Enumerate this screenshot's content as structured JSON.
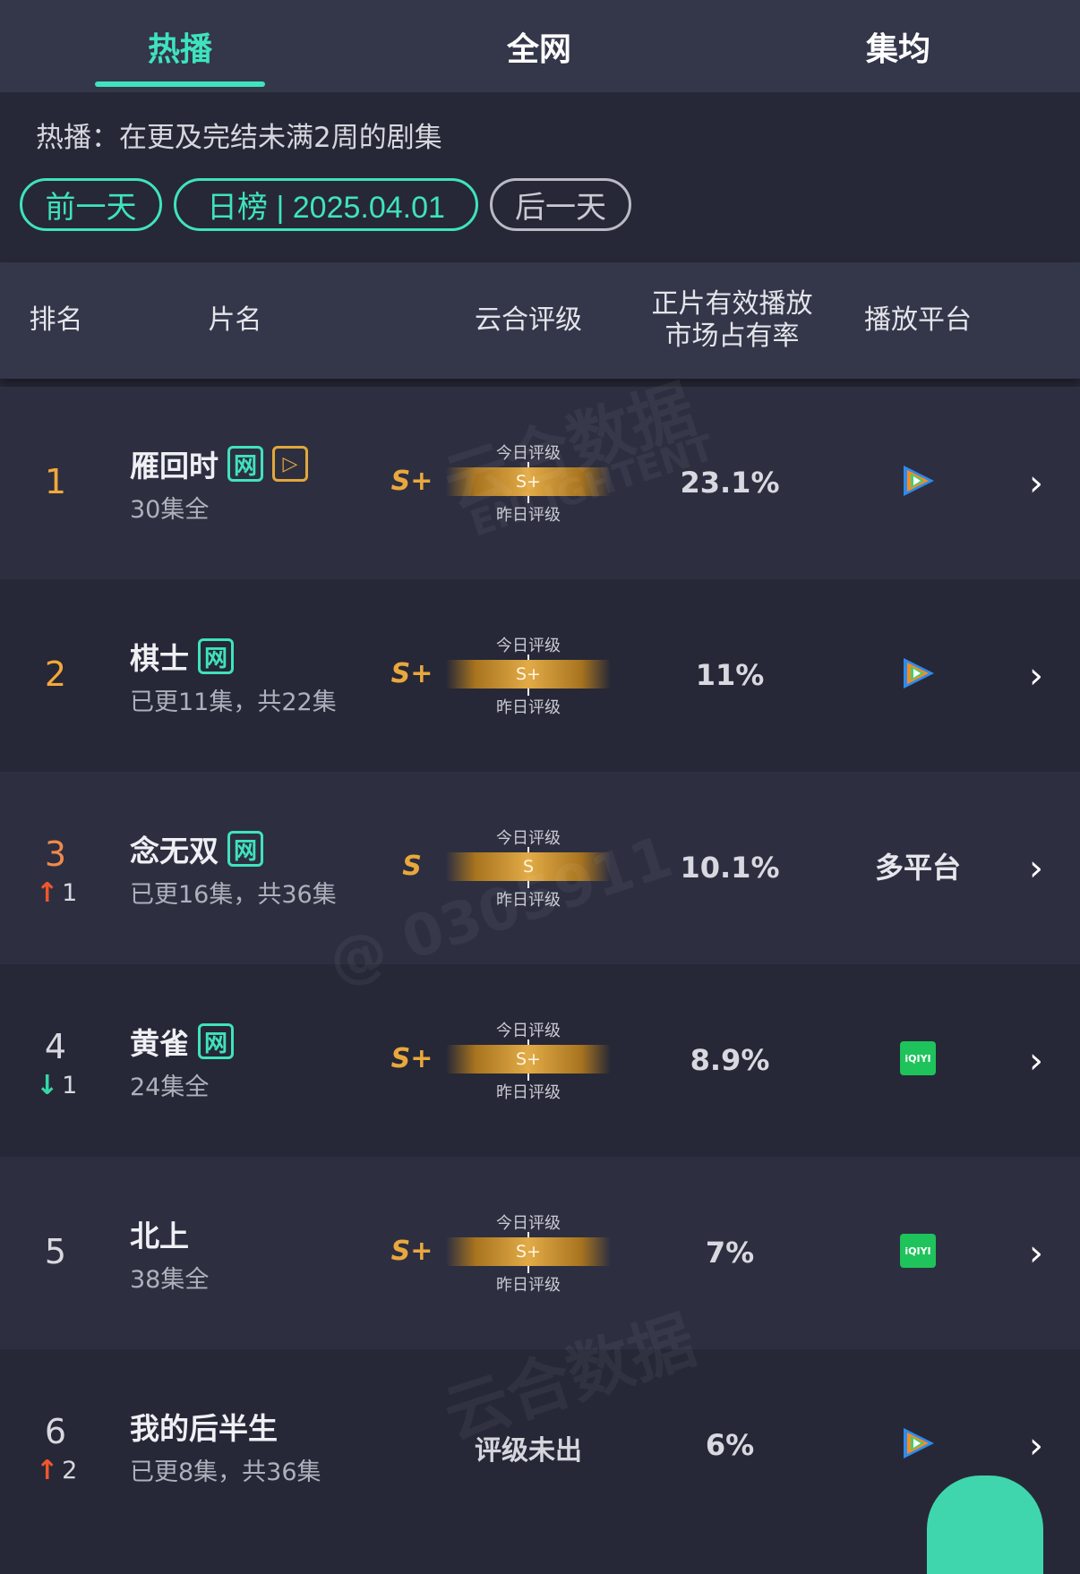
{
  "tabs": [
    {
      "label": "热播",
      "active": true
    },
    {
      "label": "全网",
      "active": false
    },
    {
      "label": "集均",
      "active": false
    }
  ],
  "description": "热播：在更及完结未满2周的剧集",
  "date_nav": {
    "prev_label": "前一天",
    "current_label": "日榜 | 2025.04.01",
    "next_label": "后一天"
  },
  "columns": {
    "rank": "排名",
    "title": "片名",
    "grade": "云合评级",
    "share_line1": "正片有效播放",
    "share_line2": "市场占有率",
    "platform": "播放平台"
  },
  "grade_labels": {
    "today": "今日评级",
    "yesterday": "昨日评级"
  },
  "watermark": {
    "brand": "云合数据",
    "en": "ENLIGHTENT",
    "handle": "@ 0305911"
  },
  "rows": [
    {
      "rank": "1",
      "change": "",
      "title": "雁回时",
      "tags": [
        "网",
        "▷"
      ],
      "subtitle": "30集全",
      "grade": "S+",
      "bar_grade": "S+",
      "share": "23.1%",
      "platform": "tencent-video-icon"
    },
    {
      "rank": "2",
      "change": "",
      "title": "棋士",
      "tags": [
        "网"
      ],
      "subtitle": "已更11集，共22集",
      "grade": "S+",
      "bar_grade": "S+",
      "share": "11%",
      "platform": "tencent-video-icon"
    },
    {
      "rank": "3",
      "change": "1",
      "change_dir": "up",
      "title": "念无双",
      "tags": [
        "网"
      ],
      "subtitle": "已更16集，共36集",
      "grade": "S",
      "bar_grade": "S",
      "share": "10.1%",
      "platform_text": "多平台"
    },
    {
      "rank": "4",
      "change": "1",
      "change_dir": "down",
      "title": "黄雀",
      "tags": [
        "网"
      ],
      "subtitle": "24集全",
      "grade": "S+",
      "bar_grade": "S+",
      "share": "8.9%",
      "platform": "iqiyi-icon",
      "platform_logo": "iQIYI"
    },
    {
      "rank": "5",
      "change": "",
      "title": "北上",
      "tags": [],
      "subtitle": "38集全",
      "grade": "S+",
      "bar_grade": "S+",
      "share": "7%",
      "platform": "iqiyi-icon",
      "platform_logo": "iQIYI"
    },
    {
      "rank": "6",
      "change": "2",
      "change_dir": "up",
      "title": "我的后半生",
      "tags": [],
      "subtitle": "已更8集，共36集",
      "grade_none": "评级未出",
      "share": "6%",
      "platform": "tencent-video-icon"
    }
  ],
  "colors": {
    "accent": "#3fe3bd",
    "gold": "#e9a83d",
    "up": "#f0562c",
    "down": "#36d6a7",
    "bg": "#262837",
    "header_bg": "#34364a"
  }
}
